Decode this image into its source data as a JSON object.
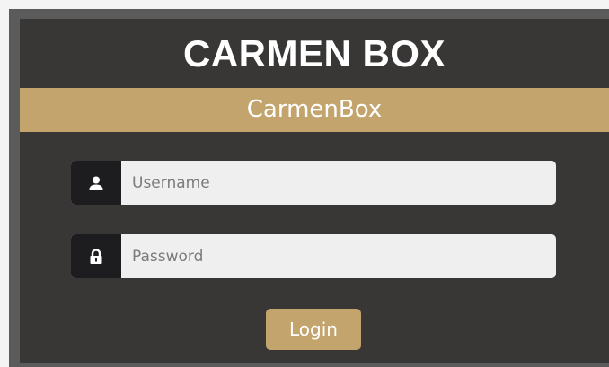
{
  "header": {
    "title": "CARMEN BOX",
    "subtitle": "CarmenBox"
  },
  "form": {
    "username": {
      "icon": "user-icon",
      "placeholder": "Username",
      "value": ""
    },
    "password": {
      "icon": "lock-icon",
      "placeholder": "Password",
      "value": ""
    },
    "login_label": "Login"
  },
  "colors": {
    "accent": "#c4a46d",
    "panel": "#383736",
    "icon_box": "#1d1d1f",
    "input_bg": "#efefef"
  }
}
